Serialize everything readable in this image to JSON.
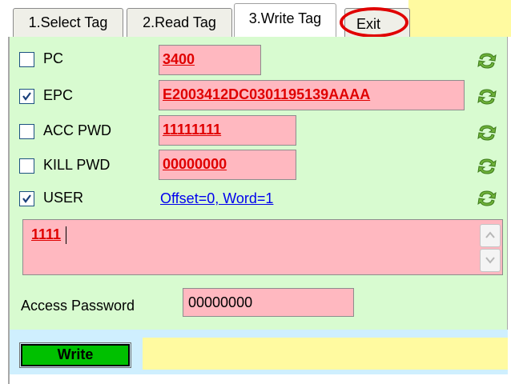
{
  "tabs": [
    {
      "label": "1.Select Tag"
    },
    {
      "label": "2.Read Tag"
    },
    {
      "label": "3.Write Tag"
    },
    {
      "label": "Exit"
    }
  ],
  "active_tab": "3.Write Tag",
  "fields": {
    "pc": {
      "label": "PC",
      "checked": false,
      "value": "3400"
    },
    "epc": {
      "label": "EPC",
      "checked": true,
      "value": "E2003412DC0301195139AAAA"
    },
    "acc_pwd": {
      "label": "ACC PWD",
      "checked": false,
      "value": "11111111"
    },
    "kill_pwd": {
      "label": "KILL PWD",
      "checked": false,
      "value": "00000000"
    },
    "user": {
      "label": "USER",
      "checked": true,
      "link": "Offset=0, Word=1"
    }
  },
  "user_data": {
    "value": "1111"
  },
  "access_password": {
    "label": "Access Password",
    "value": "00000000"
  },
  "write_button": {
    "label": "Write"
  },
  "colors": {
    "panel_bg": "#d8fbd0",
    "field_bg": "#ffb8c0",
    "field_text": "#e00000",
    "write_btn": "#00c000",
    "status_bg": "#fffaa0",
    "bottom_bg": "#cfeffe",
    "highlight_ring": "#e00000"
  },
  "icons": {
    "refresh": "refresh-icon",
    "check": "checkmark-icon",
    "scroll_up": "arrow-up-icon",
    "scroll_down": "arrow-down-icon"
  }
}
